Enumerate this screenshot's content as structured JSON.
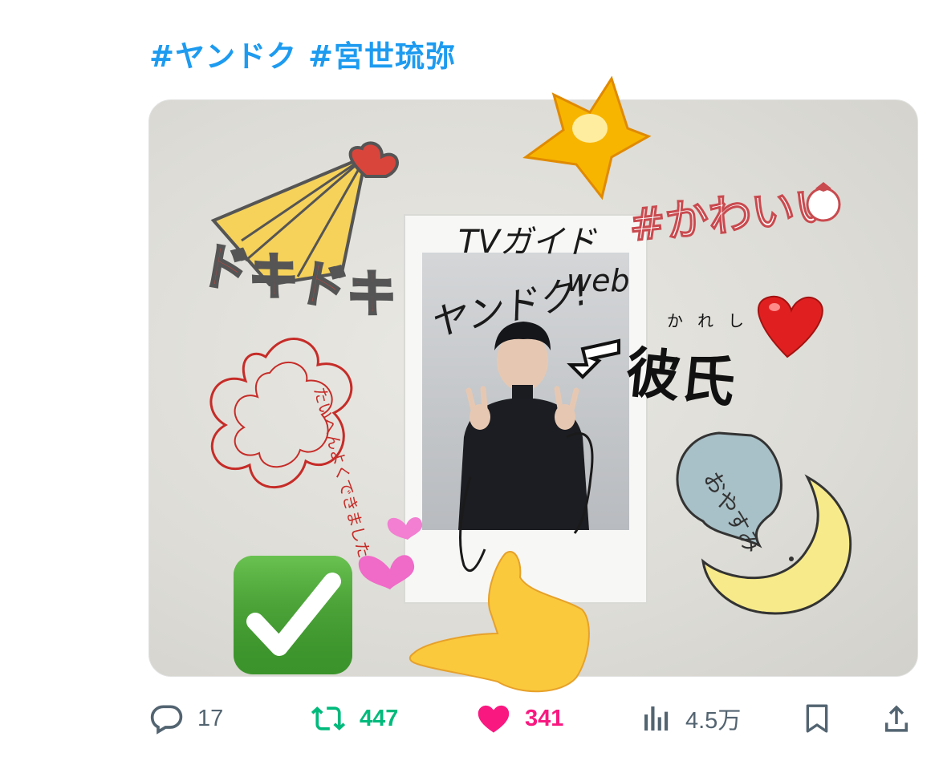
{
  "tweet": {
    "hashtags": [
      "#ヤンドク",
      "#宮世琉弥"
    ]
  },
  "media": {
    "stickers": {
      "doki": "ドキドキ",
      "kawaii": "#かわいい",
      "kareshi": "彼氏",
      "kareshi_ruby": "かれし",
      "taihen": "たいへんよくできました。",
      "oyasumi": "おやすみ"
    },
    "polaroid": {
      "handwriting_line1": "TVガイド",
      "handwriting_line2": "ヤンドク!",
      "handwriting_line3": "web"
    },
    "icons": [
      "star-icon",
      "heart-icon",
      "pink-hearts-icon",
      "check-mark-button-icon",
      "pointing-hand-icon",
      "crescent-moon-icon"
    ]
  },
  "actions": {
    "reply_count": "17",
    "retweet_count": "447",
    "like_count": "341",
    "view_count": "4.5万"
  },
  "colors": {
    "link": "#1d9bf0",
    "retweet": "#00ba7c",
    "like": "#f91880",
    "muted": "#536471"
  }
}
